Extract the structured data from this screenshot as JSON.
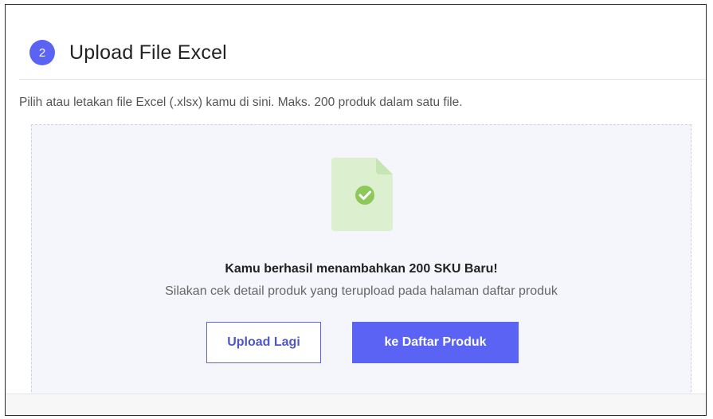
{
  "step": {
    "number": "2",
    "title": "Upload File Excel"
  },
  "description": "Pilih atau letakan file Excel (.xlsx) kamu di sini. Maks. 200 produk dalam satu file.",
  "upload_result": {
    "icon": "file-check-icon",
    "title": "Kamu berhasil menambahkan 200 SKU Baru!",
    "subtitle": "Silakan cek detail produk yang terupload pada halaman daftar produk"
  },
  "buttons": {
    "upload_again": "Upload Lagi",
    "go_to_products": "ke Daftar Produk"
  },
  "colors": {
    "accent": "#5b63f5",
    "success_icon": "#8cc95a",
    "file_icon_bg": "#dcefcf"
  }
}
